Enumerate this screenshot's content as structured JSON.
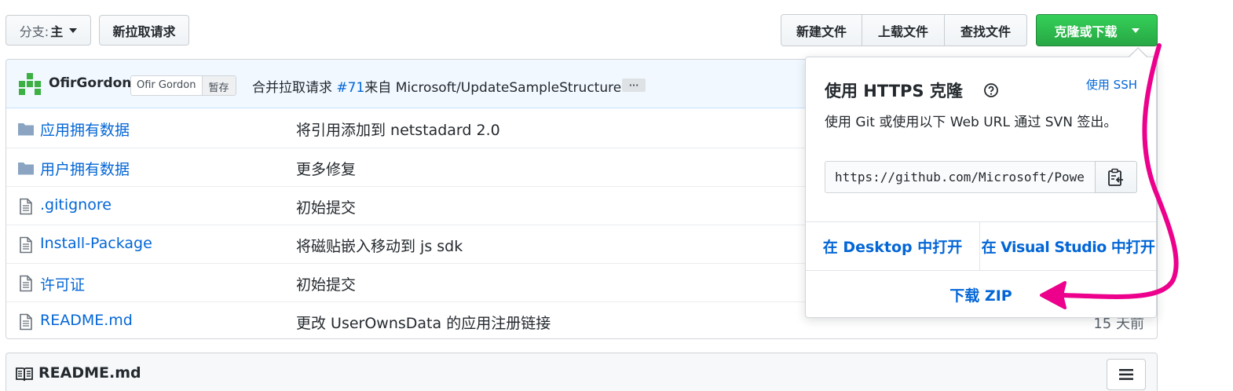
{
  "branch": {
    "label": "分支:",
    "value": "主"
  },
  "new_pull_request": "新拉取请求",
  "file_actions": {
    "create": "新建文件",
    "upload": "上载文件",
    "find": "查找文件"
  },
  "clone_button": "克隆或下载",
  "commit": {
    "author": "OfirGordon",
    "committer": "Ofir Gordon",
    "status": "暂存",
    "message_prefix": "合并拉取请求 ",
    "pr_number": "#71",
    "message_suffix": "来自 Microsoft/UpdateSampleStructure",
    "ellipsis": "···"
  },
  "files": [
    {
      "type": "folder",
      "name": "应用拥有数据",
      "message": "将引用添加到 netstadard 2.0",
      "age": ""
    },
    {
      "type": "folder",
      "name": "用户拥有数据",
      "message": "更多修复",
      "age": ""
    },
    {
      "type": "file",
      "name": ".gitignore",
      "message": "初始提交",
      "age": ""
    },
    {
      "type": "file",
      "name": "Install-Package",
      "message": "将磁贴嵌入移动到 js sdk",
      "age": ""
    },
    {
      "type": "file",
      "name": "许可证",
      "message": "初始提交",
      "age": ""
    },
    {
      "type": "file",
      "name": "README.md",
      "message": "更改 UserOwnsData 的应用注册链接",
      "age": "15 天前"
    }
  ],
  "readme": {
    "title": "README.md"
  },
  "clone_panel": {
    "title": "使用 HTTPS 克隆",
    "use_ssh": "使用 SSH",
    "description": "使用 Git 或使用以下 Web URL 通过 SVN 签出。",
    "url": "https://github.com/Microsoft/PowerBI-Developer-Samples.git",
    "open_desktop": "在 Desktop 中打开",
    "open_vs": "在 Visual Studio 中打开",
    "download_zip": "下载 ZIP"
  },
  "colors": {
    "link": "#0366d6",
    "clone_green": "#28a745",
    "annotation_pink": "#ec008c"
  }
}
